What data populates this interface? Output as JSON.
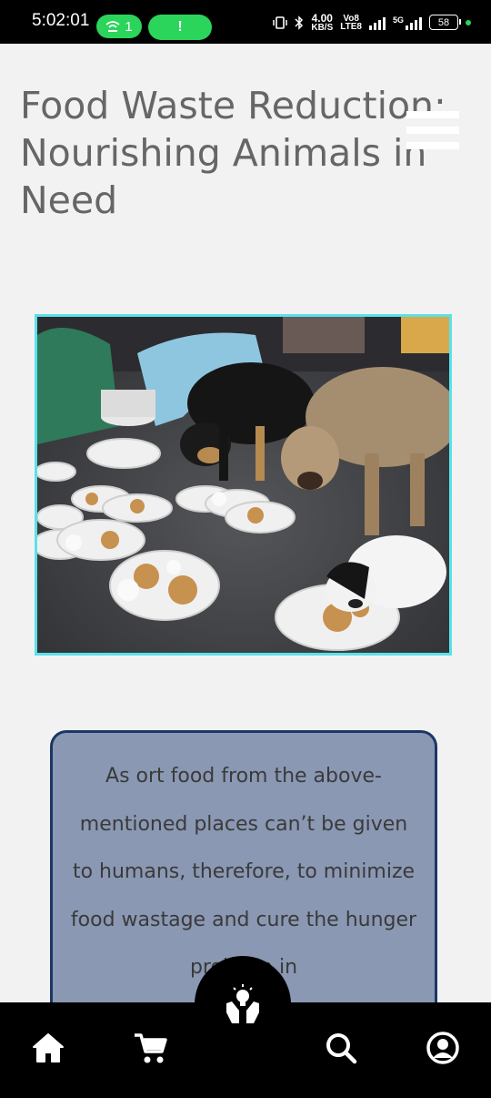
{
  "status_bar": {
    "time": "5:02:01",
    "hotspot_count": "1",
    "alert_label": "!",
    "net_speed_value": "4.00",
    "net_speed_unit": "KB/S",
    "volte_top": "Vo8",
    "volte_bottom": "LTE8",
    "network_label": "5G",
    "battery_level": "58"
  },
  "header": {
    "title": "Food Waste Reduction: Nourishing Animals in Need",
    "menu_icon": "hamburger-menu-icon"
  },
  "image": {
    "subject": "stray dogs eating leftover food from plates on a street",
    "border_color": "#5ae1ea"
  },
  "quote_card": {
    "text": "As ort food from the above-mentioned places can’t be given to humans, therefore, to minimize food wastage and cure the hunger problem in",
    "background_color": "#8a98b3",
    "border_color": "#1c3666"
  },
  "bottom_nav": {
    "items": [
      {
        "icon": "home-icon"
      },
      {
        "icon": "cart-icon"
      },
      {
        "icon": "search-icon"
      },
      {
        "icon": "user-profile-icon"
      }
    ],
    "fab_icon": "hands-lightbulb-icon"
  },
  "colors": {
    "page_background": "#f2f2f2",
    "title_text": "#666666",
    "accent_green": "#2bd45a"
  }
}
